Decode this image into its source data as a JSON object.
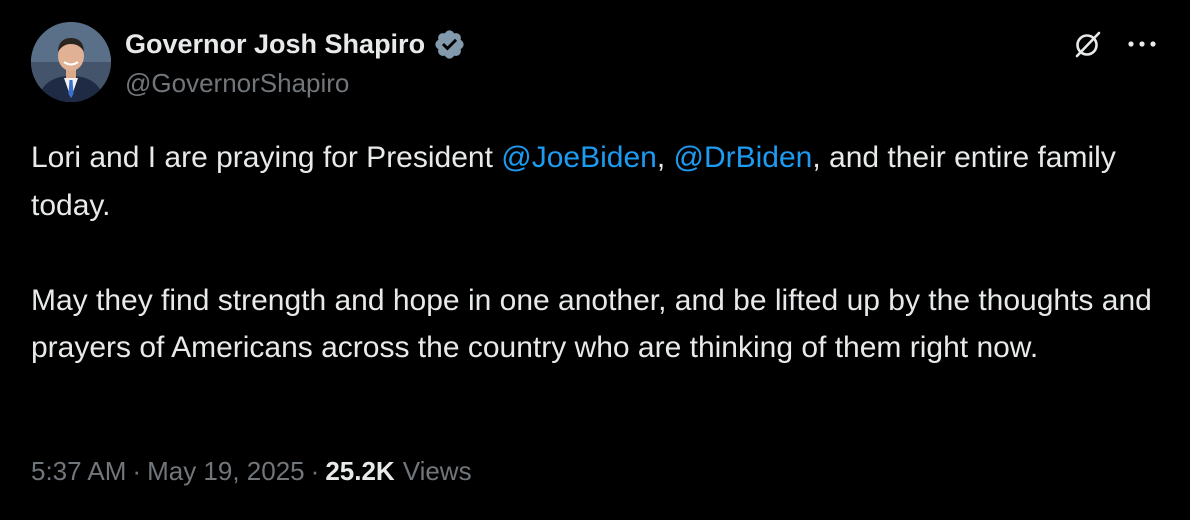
{
  "author": {
    "display_name": "Governor Josh Shapiro",
    "handle": "@GovernorShapiro",
    "verified_icon": "verified-badge-icon"
  },
  "actions": {
    "grok_icon": "grok-icon",
    "more_icon": "more-icon"
  },
  "tweet": {
    "p1_a": "Lori and I are praying for President ",
    "mention1": "@JoeBiden",
    "p1_b": ", ",
    "mention2": "@DrBiden",
    "p1_c": ", and their entire family today.",
    "p2": "May they find strength and hope in one another, and be lifted up by the thoughts and prayers of Americans across the country who are thinking of them right now."
  },
  "meta": {
    "time": "5:37 AM",
    "separator": "·",
    "date": "May 19, 2025",
    "views_count": "25.2K",
    "views_label": "Views"
  },
  "colors": {
    "background": "#000000",
    "text": "#e7e9ea",
    "secondary": "#71767b",
    "mention": "#1d9bf0",
    "badge": "#829aab"
  }
}
